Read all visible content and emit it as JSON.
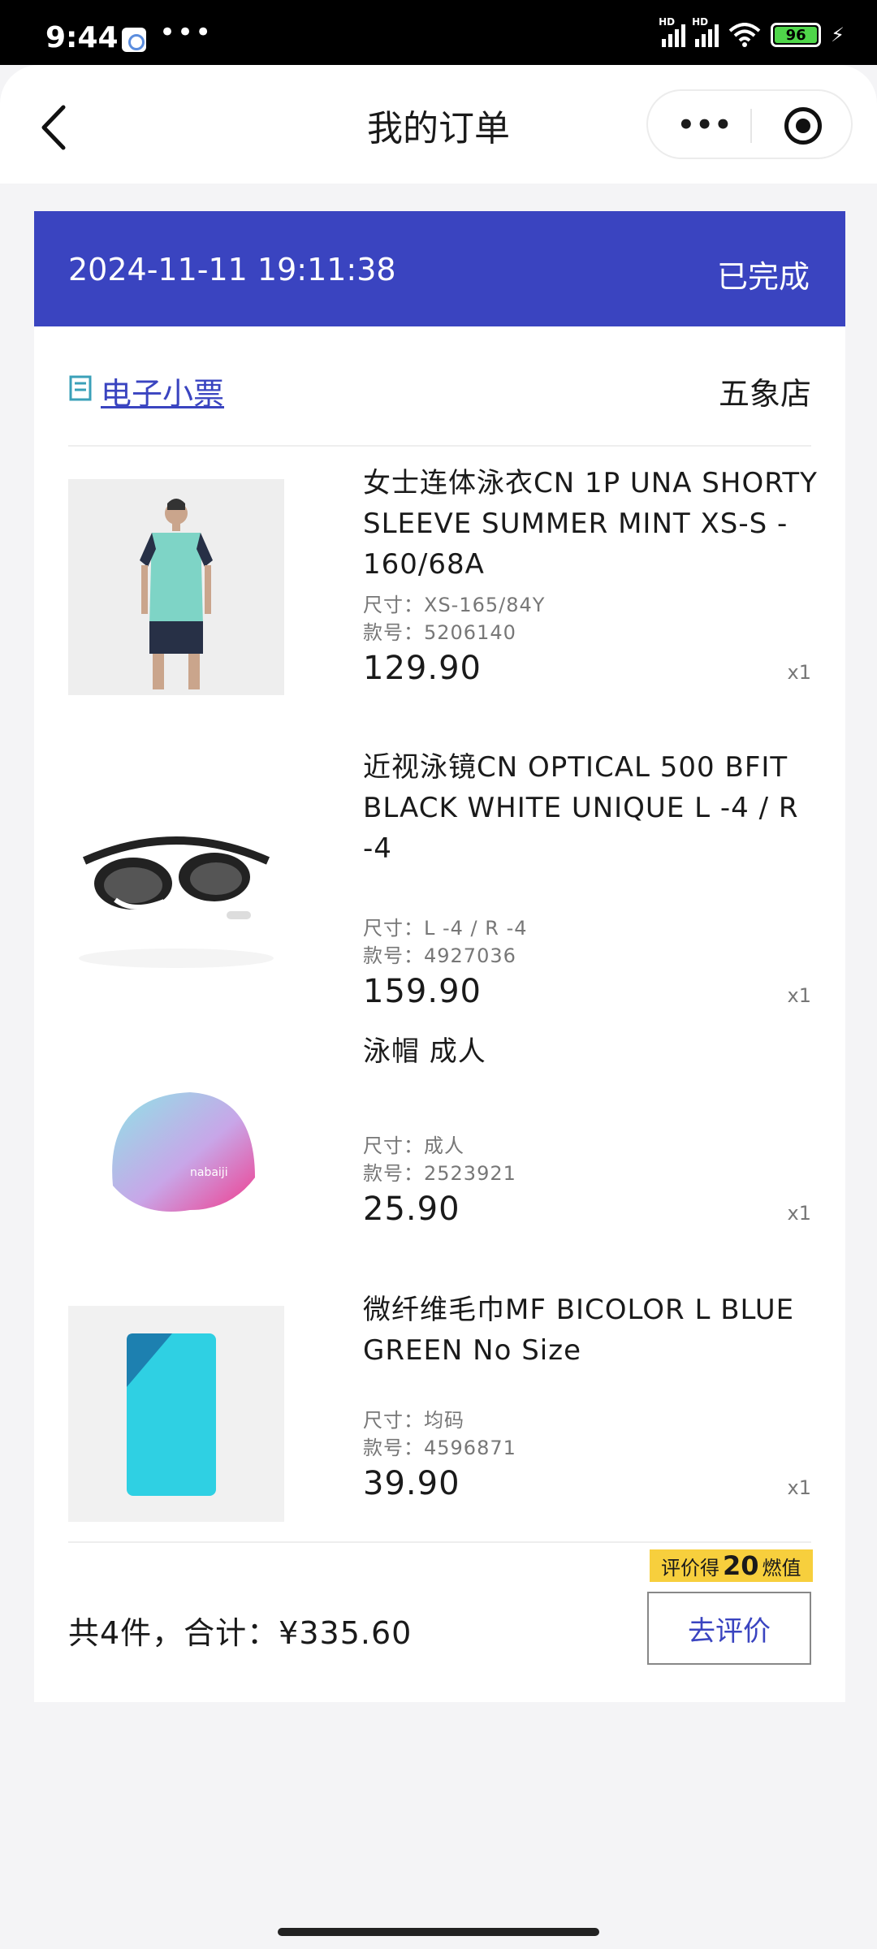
{
  "status_bar": {
    "time": "9:44",
    "dots": "•••",
    "signal_label_1": "HD",
    "signal_label_2": "HD",
    "battery": "96"
  },
  "header": {
    "title": "我的订单",
    "more_label": "•••"
  },
  "order": {
    "datetime": "2024-11-11 19:11:38",
    "status": "已完成",
    "receipt_link": "电子小票",
    "store": "五象店",
    "items": [
      {
        "name": "女士连体泳衣CN 1P UNA SHORTY SLEEVE SUMMER MINT XS-S - 160/68A",
        "size": "尺寸：XS-165/84Y",
        "code": "款号：5206140",
        "price": "129.90",
        "qty": "x1"
      },
      {
        "name": "近视泳镜CN OPTICAL 500 BFIT BLACK WHITE UNIQUE L -4 / R -4",
        "size": "尺寸：L -4 / R -4",
        "code": "款号：4927036",
        "price": "159.90",
        "qty": "x1"
      },
      {
        "name": "泳帽 成人",
        "size": "尺寸：成人",
        "code": "款号：2523921",
        "price": "25.90",
        "qty": "x1"
      },
      {
        "name": "微纤维毛巾MF BICOLOR L BLUE GREEN No Size",
        "size": "尺寸：均码",
        "code": "款号：4596871",
        "price": "39.90",
        "qty": "x1"
      }
    ],
    "total": "共4件，合计：¥335.60",
    "review_tag_prefix": "评价得",
    "review_tag_points": "20",
    "review_tag_suffix": "燃值",
    "review_button": "去评价"
  },
  "colors": {
    "accent": "#3a44c0",
    "tag_yellow": "#f7cf3d"
  },
  "icons": [
    "back-arrow-icon",
    "more-icon",
    "target-icon",
    "receipt-icon",
    "wifi-icon",
    "battery-icon"
  ]
}
